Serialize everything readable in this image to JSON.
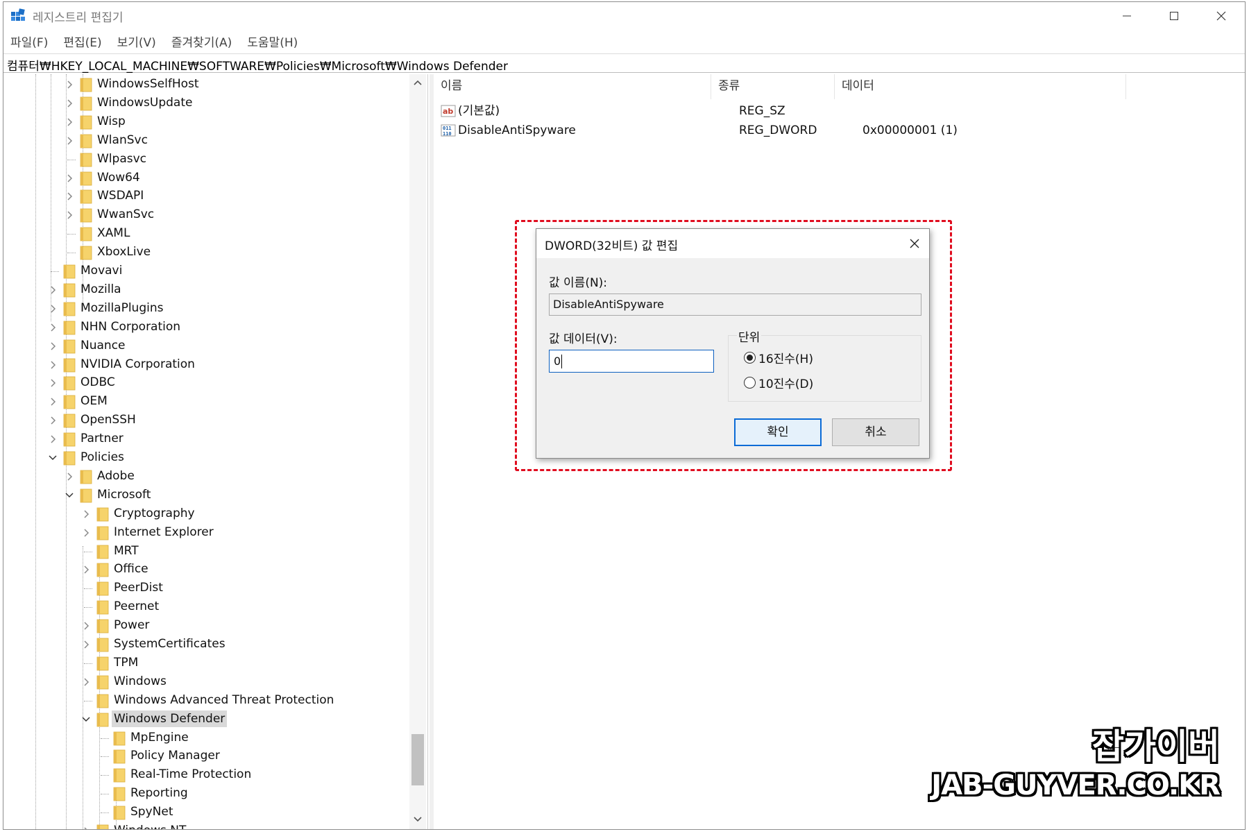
{
  "window": {
    "title": "레지스트리 편집기",
    "icon": "registry-editor-icon",
    "controls": [
      "minimize-icon",
      "maximize-icon",
      "close-icon"
    ]
  },
  "menu": [
    "파일(F)",
    "편집(E)",
    "보기(V)",
    "즐겨찾기(A)",
    "도움말(H)"
  ],
  "address": "컴퓨터₩HKEY_LOCAL_MACHINE₩SOFTWARE₩Policies₩Microsoft₩Windows Defender",
  "tree": [
    {
      "label": "WindowsSelfHost",
      "level": 2,
      "expander": "collapsed"
    },
    {
      "label": "WindowsUpdate",
      "level": 2,
      "expander": "collapsed"
    },
    {
      "label": "Wisp",
      "level": 2,
      "expander": "collapsed"
    },
    {
      "label": "WlanSvc",
      "level": 2,
      "expander": "collapsed"
    },
    {
      "label": "Wlpasvc",
      "level": 2,
      "expander": "none"
    },
    {
      "label": "Wow64",
      "level": 2,
      "expander": "collapsed"
    },
    {
      "label": "WSDAPI",
      "level": 2,
      "expander": "collapsed"
    },
    {
      "label": "WwanSvc",
      "level": 2,
      "expander": "collapsed"
    },
    {
      "label": "XAML",
      "level": 2,
      "expander": "none"
    },
    {
      "label": "XboxLive",
      "level": 2,
      "expander": "none"
    },
    {
      "label": "Movavi",
      "level": 1,
      "expander": "none"
    },
    {
      "label": "Mozilla",
      "level": 1,
      "expander": "collapsed"
    },
    {
      "label": "MozillaPlugins",
      "level": 1,
      "expander": "collapsed"
    },
    {
      "label": "NHN Corporation",
      "level": 1,
      "expander": "collapsed"
    },
    {
      "label": "Nuance",
      "level": 1,
      "expander": "collapsed"
    },
    {
      "label": "NVIDIA Corporation",
      "level": 1,
      "expander": "collapsed"
    },
    {
      "label": "ODBC",
      "level": 1,
      "expander": "collapsed"
    },
    {
      "label": "OEM",
      "level": 1,
      "expander": "collapsed"
    },
    {
      "label": "OpenSSH",
      "level": 1,
      "expander": "collapsed"
    },
    {
      "label": "Partner",
      "level": 1,
      "expander": "collapsed"
    },
    {
      "label": "Policies",
      "level": 1,
      "expander": "expanded"
    },
    {
      "label": "Adobe",
      "level": 2,
      "expander": "collapsed"
    },
    {
      "label": "Microsoft",
      "level": 2,
      "expander": "expanded"
    },
    {
      "label": "Cryptography",
      "level": 3,
      "expander": "collapsed"
    },
    {
      "label": "Internet Explorer",
      "level": 3,
      "expander": "collapsed"
    },
    {
      "label": "MRT",
      "level": 3,
      "expander": "none"
    },
    {
      "label": "Office",
      "level": 3,
      "expander": "collapsed"
    },
    {
      "label": "PeerDist",
      "level": 3,
      "expander": "none"
    },
    {
      "label": "Peernet",
      "level": 3,
      "expander": "none"
    },
    {
      "label": "Power",
      "level": 3,
      "expander": "collapsed"
    },
    {
      "label": "SystemCertificates",
      "level": 3,
      "expander": "collapsed"
    },
    {
      "label": "TPM",
      "level": 3,
      "expander": "none"
    },
    {
      "label": "Windows",
      "level": 3,
      "expander": "collapsed"
    },
    {
      "label": "Windows Advanced Threat Protection",
      "level": 3,
      "expander": "none"
    },
    {
      "label": "Windows Defender",
      "level": 3,
      "expander": "expanded",
      "selected": true
    },
    {
      "label": "MpEngine",
      "level": 4,
      "expander": "none"
    },
    {
      "label": "Policy Manager",
      "level": 4,
      "expander": "none"
    },
    {
      "label": "Real-Time Protection",
      "level": 4,
      "expander": "none"
    },
    {
      "label": "Reporting",
      "level": 4,
      "expander": "none"
    },
    {
      "label": "SpyNet",
      "level": 4,
      "expander": "none"
    },
    {
      "label": "Windows NT",
      "level": 3,
      "expander": "collapsed"
    }
  ],
  "values": {
    "headers": [
      "이름",
      "종류",
      "데이터"
    ],
    "rows": [
      {
        "icon": "string-value-icon",
        "name": "(기본값)",
        "type": "REG_SZ",
        "data": ""
      },
      {
        "icon": "binary-value-icon",
        "name": "DisableAntiSpyware",
        "type": "REG_DWORD",
        "data": "0x00000001 (1)"
      }
    ]
  },
  "dialog": {
    "title": "DWORD(32비트) 값 편집",
    "name_label": "값 이름(N):",
    "name_value": "DisableAntiSpyware",
    "data_label": "값 데이터(V):",
    "data_value": "0",
    "base_label": "단위",
    "radio_hex": "16진수(H)",
    "radio_dec": "10진수(D)",
    "selected_base": "hex",
    "ok": "확인",
    "cancel": "취소"
  },
  "watermark": {
    "title": "잡가이버",
    "url": "JAB-GUYVER.CO.KR"
  },
  "colors": {
    "highlight": "#e00d1f",
    "folder": "#f6d36b",
    "selection": "#d9d9d9",
    "focus": "#0b6bd6"
  }
}
